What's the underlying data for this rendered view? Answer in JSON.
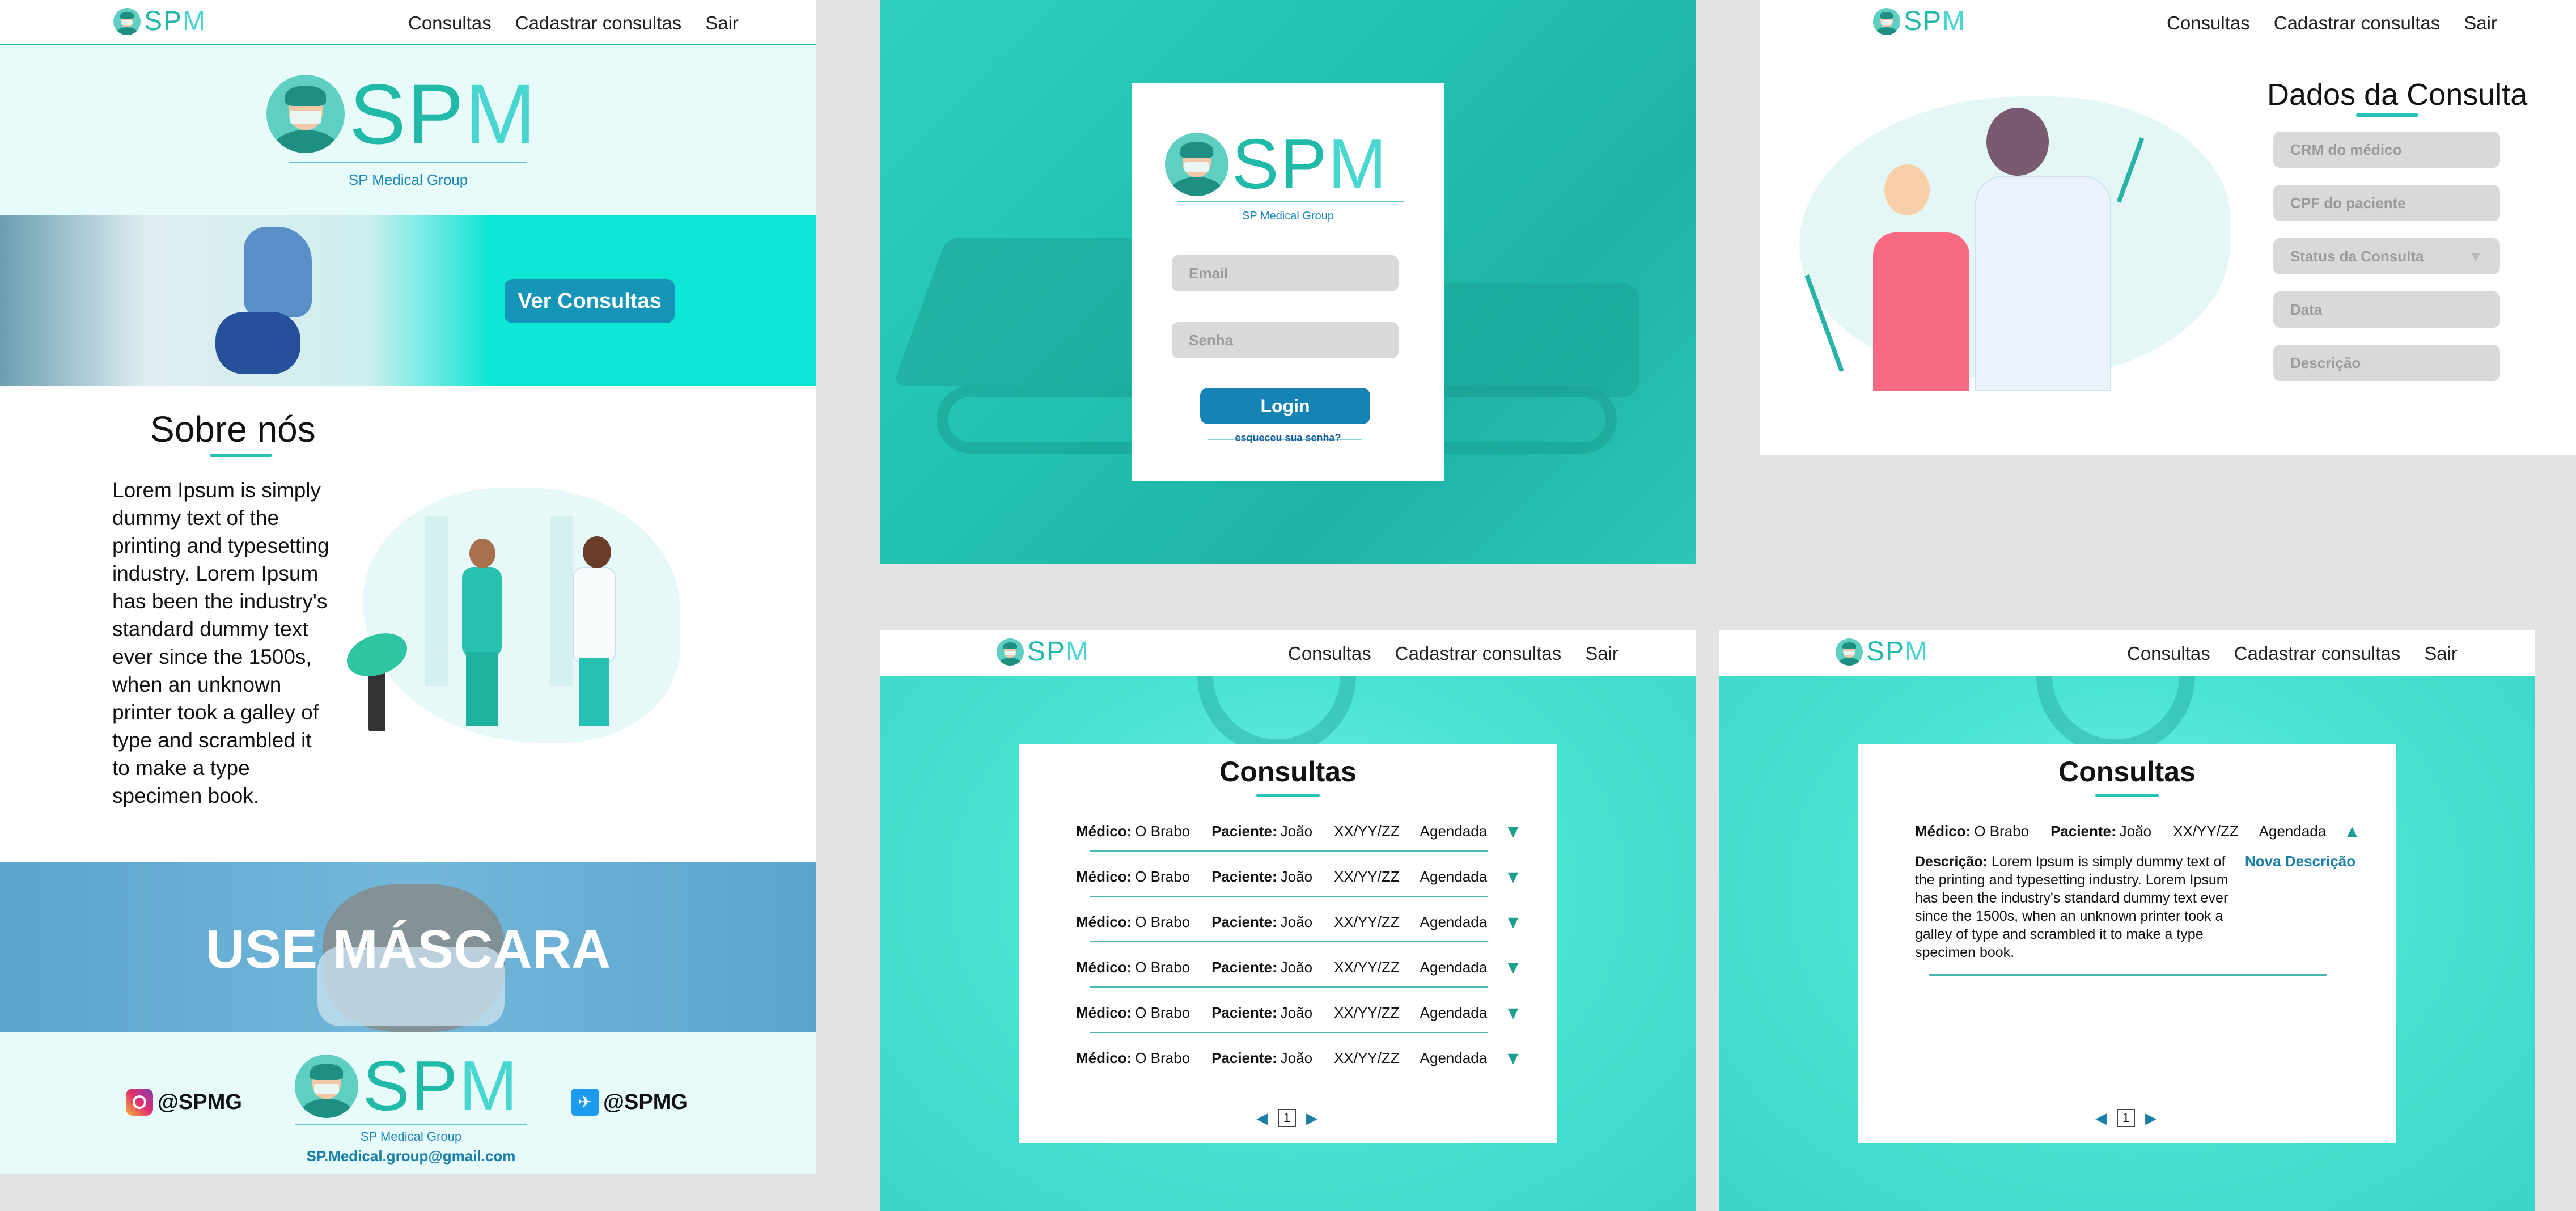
{
  "brand": {
    "logo_s": "S",
    "logo_p": "P",
    "logo_m": "M",
    "tagline": "SP Medical Group"
  },
  "nav": {
    "consultas": "Consultas",
    "cadastrar": "Cadastrar consultas",
    "sair": "Sair"
  },
  "home": {
    "hero_button": "Ver Consultas",
    "about_title": "Sobre nós",
    "about_text": "Lorem Ipsum is simply dummy text of the printing and typesetting industry. Lorem Ipsum has been the industry's standard dummy text ever since the 1500s, when an unknown printer took a galley of type and scrambled it to make a type specimen book.",
    "banner_text": "USE MÁSCARA",
    "instagram": "@SPMG",
    "twitter": "@SPMG",
    "email": "SP.Medical.group@gmail.com"
  },
  "login": {
    "email_placeholder": "Email",
    "password_placeholder": "Senha",
    "button": "Login",
    "forgot": "esqueceu sua senha?"
  },
  "cadastro": {
    "title": "Dados da Consulta",
    "fields": {
      "crm": "CRM do médico",
      "cpf": "CPF do paciente",
      "status": "Status da Consulta",
      "data": "Data",
      "descricao": "Descrição"
    }
  },
  "consultas": {
    "title": "Consultas",
    "labels": {
      "medico": "Médico:",
      "paciente": "Paciente:",
      "descricao": "Descrição:"
    },
    "rows": [
      {
        "medico": "O Brabo",
        "paciente": "João",
        "data": "XX/YY/ZZ",
        "status": "Agendada"
      },
      {
        "medico": "O Brabo",
        "paciente": "João",
        "data": "XX/YY/ZZ",
        "status": "Agendada"
      },
      {
        "medico": "O Brabo",
        "paciente": "João",
        "data": "XX/YY/ZZ",
        "status": "Agendada"
      },
      {
        "medico": "O Brabo",
        "paciente": "João",
        "data": "XX/YY/ZZ",
        "status": "Agendada"
      },
      {
        "medico": "O Brabo",
        "paciente": "João",
        "data": "XX/YY/ZZ",
        "status": "Agendada"
      },
      {
        "medico": "O Brabo",
        "paciente": "João",
        "data": "XX/YY/ZZ",
        "status": "Agendada"
      }
    ],
    "page": "1",
    "expanded": {
      "medico": "O Brabo",
      "paciente": "João",
      "data": "XX/YY/ZZ",
      "status": "Agendada",
      "descricao": "Lorem Ipsum is simply dummy text of the printing and typesetting industry. Lorem Ipsum has been the industry's standard dummy text ever since the 1500s, when an unknown printer took a galley of type and scrambled it to make a type specimen book.",
      "nova_descricao": "Nova Descrição"
    }
  },
  "colors": {
    "teal": "#27c0b2",
    "aqua": "#0ee6d6",
    "button_blue": "#1a93b6",
    "light_bg": "#e6fbfa"
  }
}
